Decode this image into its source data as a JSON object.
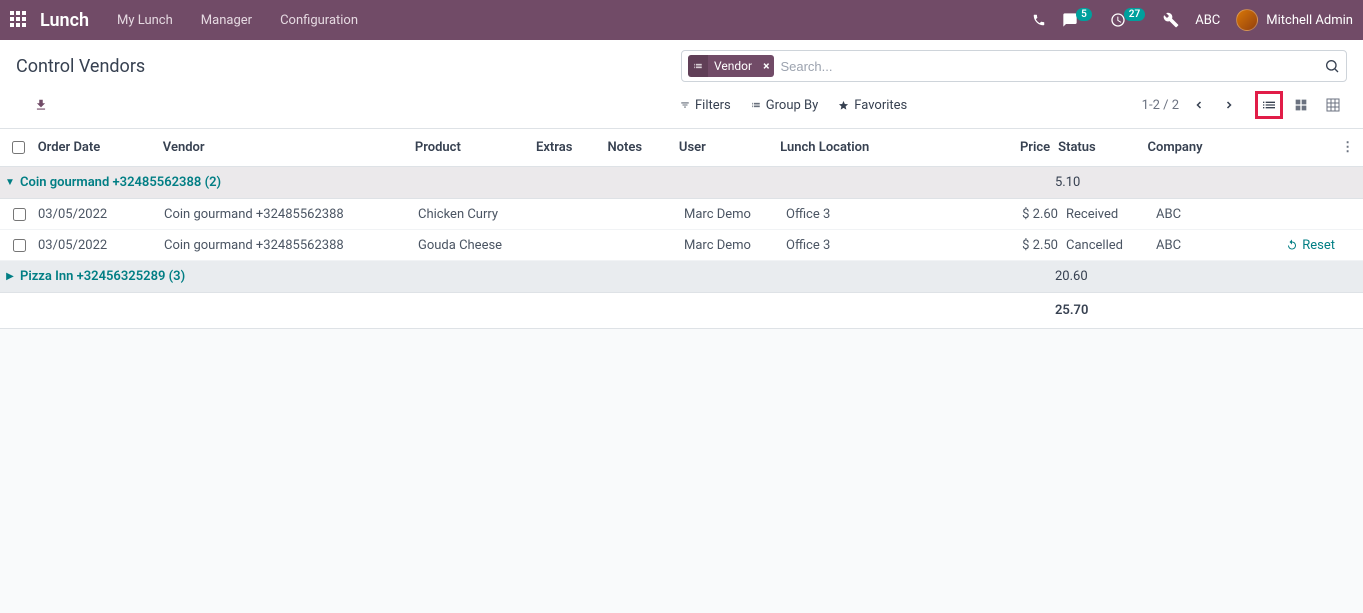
{
  "navbar": {
    "brand": "Lunch",
    "menu": [
      "My Lunch",
      "Manager",
      "Configuration"
    ],
    "chat_count": "5",
    "activity_count": "27",
    "company": "ABC",
    "user": "Mitchell Admin"
  },
  "control": {
    "title": "Control Vendors",
    "facet_label": "Vendor",
    "search_placeholder": "Search...",
    "filters_label": "Filters",
    "groupby_label": "Group By",
    "favorites_label": "Favorites",
    "pager": "1-2 / 2"
  },
  "columns": {
    "order_date": "Order Date",
    "vendor": "Vendor",
    "product": "Product",
    "extras": "Extras",
    "notes": "Notes",
    "user": "User",
    "location": "Lunch Location",
    "price": "Price",
    "status": "Status",
    "company": "Company"
  },
  "groups": [
    {
      "label": "Coin gourmand +32485562388 (2)",
      "total": "5.10",
      "expanded": true
    },
    {
      "label": "Pizza Inn +32456325289 (3)",
      "total": "20.60",
      "expanded": false
    }
  ],
  "rows": [
    {
      "date": "03/05/2022",
      "vendor": "Coin gourmand +32485562388",
      "product": "Chicken Curry",
      "extras": "",
      "notes": "",
      "user": "Marc Demo",
      "location": "Office 3",
      "price": "$ 2.60",
      "status": "Received",
      "company": "ABC",
      "reset": ""
    },
    {
      "date": "03/05/2022",
      "vendor": "Coin gourmand +32485562388",
      "product": "Gouda Cheese",
      "extras": "",
      "notes": "",
      "user": "Marc Demo",
      "location": "Office 3",
      "price": "$ 2.50",
      "status": "Cancelled",
      "company": "ABC",
      "reset": "Reset"
    }
  ],
  "footer_total": "25.70"
}
